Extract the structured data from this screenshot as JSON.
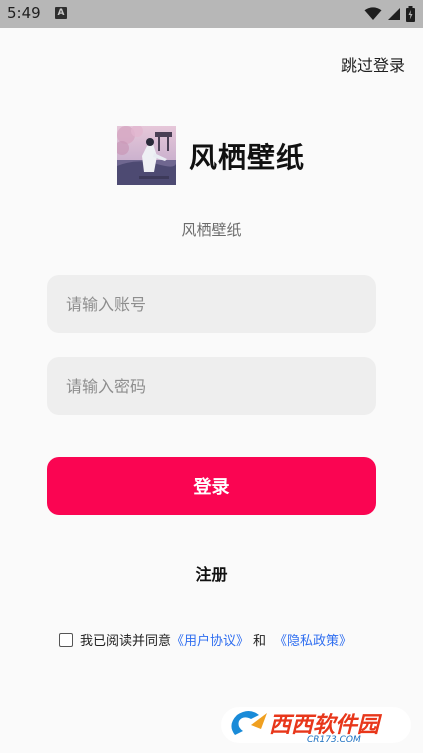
{
  "status_bar": {
    "time": "5:49",
    "notification_icon_letter": "A",
    "icons": [
      "wifi-icon",
      "cellular-icon",
      "battery-icon"
    ]
  },
  "header": {
    "skip_login_label": "跳过登录"
  },
  "brand": {
    "app_name": "风栖壁纸",
    "subtitle": "风栖壁纸"
  },
  "form": {
    "account_placeholder": "请输入账号",
    "account_value": "",
    "password_placeholder": "请输入密码",
    "password_value": "",
    "login_label": "登录",
    "register_label": "注册"
  },
  "agreement": {
    "checked": false,
    "prefix_text": "我已阅读并同意",
    "user_agreement_label": "《用户协议》",
    "conjunction": "和",
    "privacy_policy_label": "《隐私政策》"
  },
  "watermark": {
    "brand_text": "西西软件园",
    "domain_text": "CR173.COM"
  },
  "colors": {
    "primary": "#fa0552",
    "link": "#2f6ef0",
    "input_bg": "#eeeeee",
    "page_bg": "#fafafa",
    "status_bar_bg": "#b7b7b7"
  }
}
